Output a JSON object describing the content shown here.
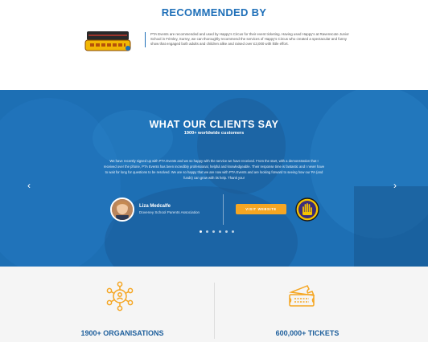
{
  "recommended": {
    "title": "RECOMMENDED BY",
    "logo_text": "HAPPY'S CIRCUS",
    "text": "PTA Events are recommended and used by Happy's Circus for their event ticketing. Having used Happy's at Ravenscote Junior School in Frimley, Surrey, we can thoroughly recommend the services of Happy's Circus who created a spectacular and funny show that engaged both adults and children alike and raised over £3,000 with little effort."
  },
  "clients": {
    "title_light": "WHAT OUR ",
    "title_bold": "CLIENTS SAY",
    "subtitle": "1900+ worldwide customers",
    "quote": "We have recently signed up with PTA Events and we so happy with the service we have received. From the start, with a demonstration that I received over the phone, PTA Events has been incredibly professional, helpful and knowledgeable. Their response time is fantastic and I never have to wait for long for questions to be resolved. We are so happy that we are now with PTA Events and are looking forward to seeing how our PA (and funds) can grow with its help. Thank you!",
    "person_name": "Liza Medcalfe",
    "person_org": "Doveney School Parents Association",
    "visit_label": "VISIT WEBSITE",
    "prev_arrow": "‹",
    "next_arrow": "›",
    "dots_count": 6,
    "accent": "#f5a623",
    "background": "#1d6fb4"
  },
  "stats": {
    "organisations_label": "1900+ ORGANISATIONS",
    "tickets_label": "600,000+ TICKETS",
    "icon_color": "#f5a623",
    "label_color": "#1e5f9c"
  },
  "icons": {
    "organisations": "network-people-icon",
    "tickets": "tickets-icon",
    "prev": "chevron-left-icon",
    "next": "chevron-right-icon"
  }
}
